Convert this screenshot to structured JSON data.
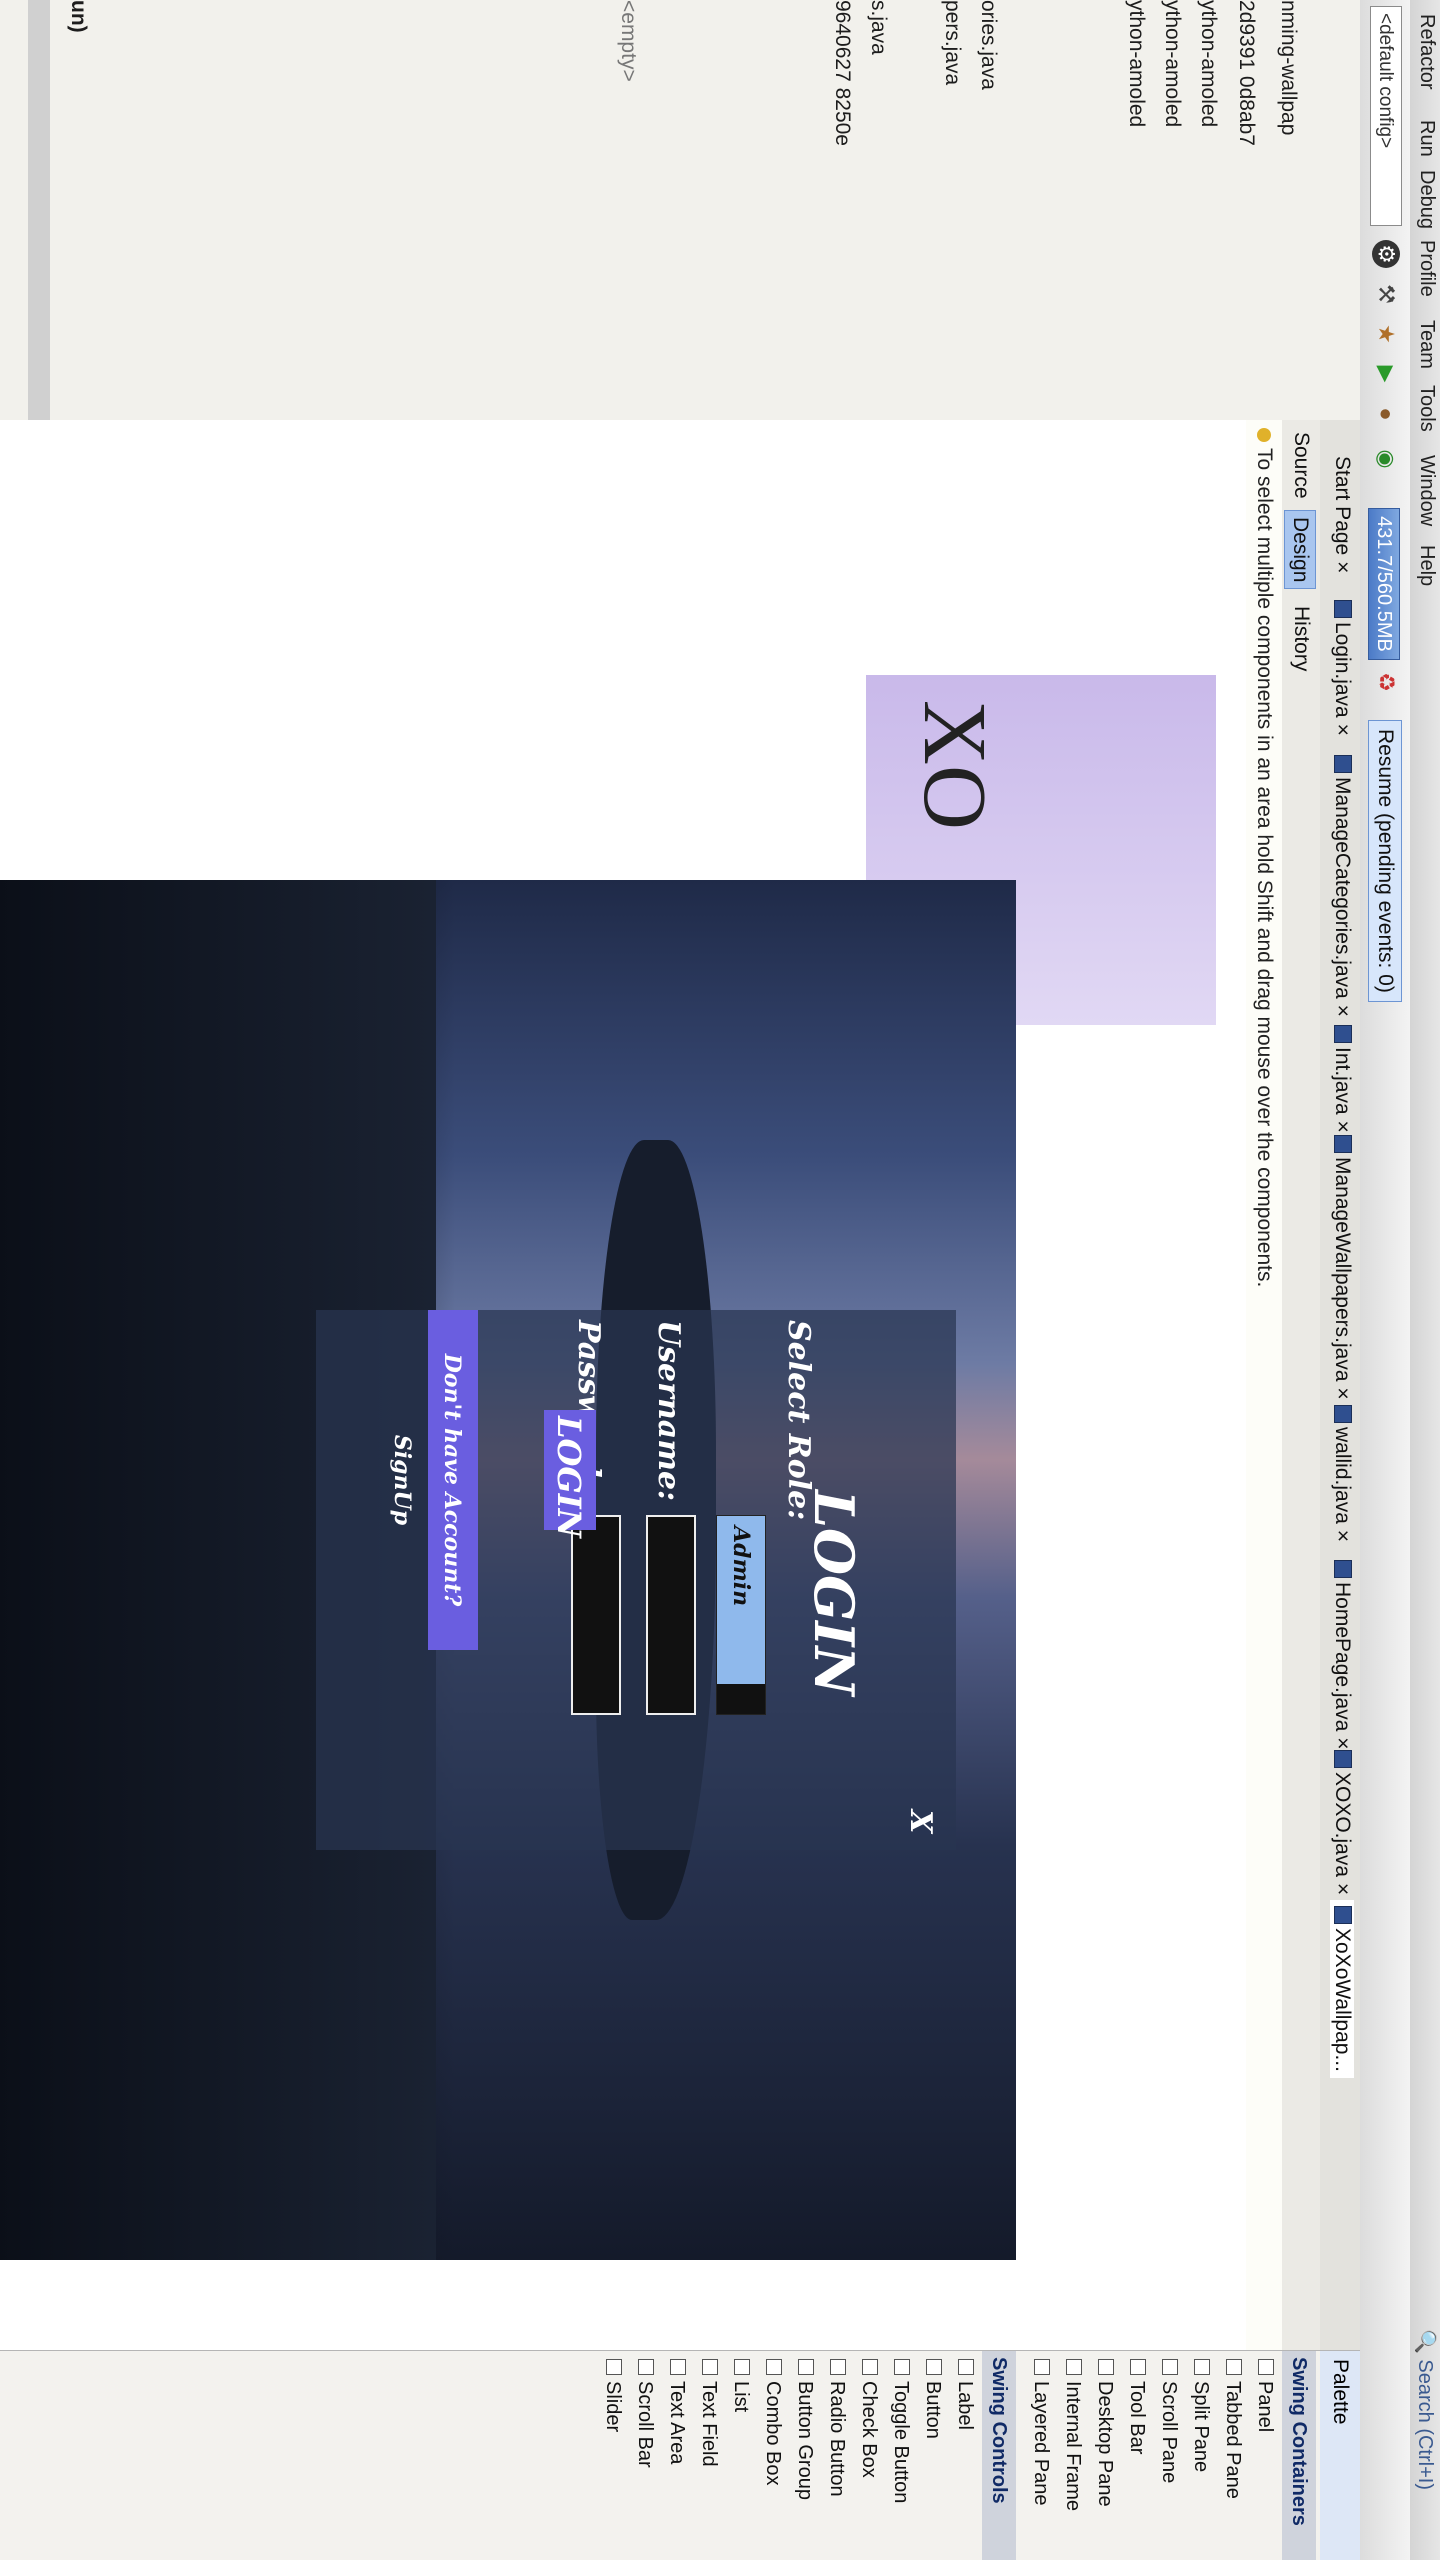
{
  "menu": [
    "Refactor",
    "Run",
    "Debug",
    "Profile",
    "Team",
    "Tools",
    "Window",
    "Help"
  ],
  "search_placeholder": "Search (Ctrl+I)",
  "toolbar": {
    "config": "<default config>",
    "memory": "431.7/560.5MB",
    "resume": "Resume (pending events: 0)"
  },
  "navigator": {
    "items": [
      "nming-wallpap",
      "2d9391 0d8ab7",
      "ython-amoled",
      "ython-amoled",
      "ython-amoled",
      "ories.java",
      "pers.java",
      "s.java",
      "9640627 8250e",
      "<empty>",
      "un)"
    ]
  },
  "editor_tabs": [
    "Start Page",
    "Login.java",
    "ManageCategories.java",
    "Int.java",
    "ManageWallpapers.java",
    "wallid.java",
    "HomePage.java",
    "XOXO.java",
    "XoXoWallpap..."
  ],
  "subtabs": [
    "Source",
    "Design",
    "History"
  ],
  "hint": "To select multiple components in an area hold Shift and drag mouse over the components.",
  "canvas_text": "XO",
  "form": {
    "close": "X",
    "title": "LOGIN",
    "role_label": "Select Role:",
    "role_value": "Admin",
    "username_label": "Username:",
    "password_label": "Password:",
    "login_button": "LOGIN",
    "signup_button": "Don't have Account? SignUp"
  },
  "palette": {
    "title": "Palette",
    "containers_header": "Swing Containers",
    "containers": [
      "Panel",
      "Tabbed Pane",
      "Split Pane",
      "Scroll Pane",
      "Tool Bar",
      "Desktop Pane",
      "Internal Frame",
      "Layered Pane"
    ],
    "controls_header": "Swing Controls",
    "controls": [
      "Label",
      "Button",
      "Toggle Button",
      "Check Box",
      "Radio Button",
      "Button Group",
      "Combo Box",
      "List",
      "Text Field",
      "Text Area",
      "Scroll Bar",
      "Slider"
    ]
  },
  "colors": {
    "button": "#6a5ee0",
    "role_select": "#8fb9ec",
    "memory": "#4b7ac7"
  }
}
